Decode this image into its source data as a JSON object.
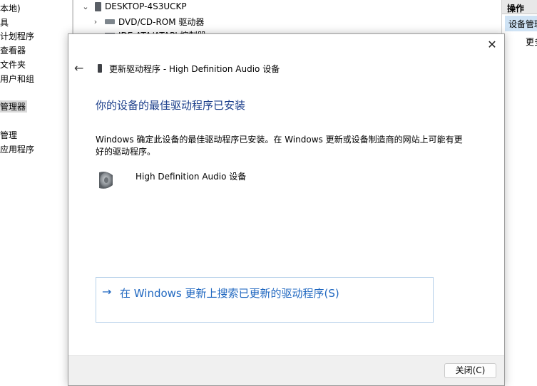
{
  "left_tree": {
    "items": [
      "本地)",
      "具",
      "计划程序",
      "查看器",
      "文件夹",
      "用户和组",
      "管理器",
      "管理",
      "应用程序"
    ]
  },
  "center_tree": {
    "root": "DESKTOP-4S3UCKP",
    "items": [
      "DVD/CD-ROM 驱动器",
      "IDE ATA/ATAPI 控制器"
    ]
  },
  "actions": {
    "header": "操作",
    "item": "设备管理",
    "sub": "更多"
  },
  "dialog": {
    "title": "更新驱动程序 - High Definition Audio 设备",
    "heading": "你的设备的最佳驱动程序已安装",
    "body": "Windows 确定此设备的最佳驱动程序已安装。在 Windows 更新或设备制造商的网站上可能有更好的驱动程序。",
    "device_name": "High Definition Audio 设备",
    "search_link": "在 Windows 更新上搜索已更新的驱动程序(S)",
    "close_label": "关闭(C)",
    "close_x": "✕",
    "back_arrow": "←",
    "link_arrow": "→"
  },
  "icons": {
    "close": "close-icon",
    "back": "back-arrow-icon",
    "speaker": "speaker-icon",
    "device": "device-icon",
    "computer": "computer-icon"
  },
  "colors": {
    "heading": "#1a3d8a",
    "link": "#1f67c0",
    "link_border": "#b7d1ea",
    "footer": "#f0f0f0",
    "selection": "#cfe3f5"
  }
}
